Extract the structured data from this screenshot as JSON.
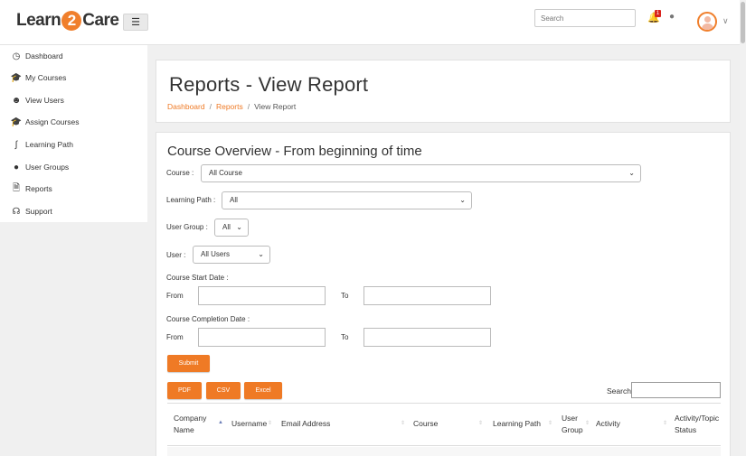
{
  "header": {
    "logo_left": "Learn",
    "logo_mid": "2",
    "logo_right": "Care",
    "menu_icon": "hamburger-icon",
    "search_placeholder": "Search",
    "notification_count": "1"
  },
  "sidebar": {
    "items": [
      {
        "label": "Dashboard",
        "icon": "dashboard-icon"
      },
      {
        "label": "My Courses",
        "icon": "graduation-cap-icon"
      },
      {
        "label": "View Users",
        "icon": "users-icon"
      },
      {
        "label": "Assign Courses",
        "icon": "graduation-cap-icon"
      },
      {
        "label": "Learning Path",
        "icon": "path-icon"
      },
      {
        "label": "User Groups",
        "icon": "user-icon"
      },
      {
        "label": "Reports",
        "icon": "file-icon"
      },
      {
        "label": "Support",
        "icon": "headset-icon"
      }
    ]
  },
  "page": {
    "title": "Reports - View Report",
    "breadcrumb": [
      "Dashboard",
      "Reports",
      "View Report"
    ]
  },
  "filters": {
    "section_title": "Course Overview - From beginning of time",
    "course_label": "Course :",
    "course_value": "All Course",
    "learning_path_label": "Learning Path :",
    "learning_path_value": "All",
    "user_group_label": "User Group :",
    "user_group_value": "All",
    "user_label": "User :",
    "user_value": "All Users",
    "start_date_label": "Course Start Date :",
    "completion_date_label": "Course Completion Date :",
    "from_label": "From",
    "to_label": "To",
    "submit_label": "Submit"
  },
  "export": {
    "pdf": "PDF",
    "csv": "CSV",
    "excel": "Excel",
    "search_label": "Search:"
  },
  "table": {
    "headers": [
      "Company Name",
      "Username",
      "Email Address",
      "Course",
      "Learning Path",
      "User Group",
      "Activity",
      "Activity/Topic Status"
    ]
  },
  "colors": {
    "accent": "#ef7a25",
    "badge": "#d9231d"
  }
}
